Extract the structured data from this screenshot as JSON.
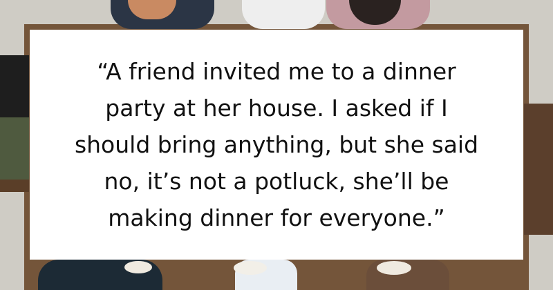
{
  "quote": {
    "lines": [
      "“A friend invited me to a dinner",
      "party at her house. I asked if I",
      "should bring anything, but she said",
      "no, it’s not a potluck, she’ll be",
      "making dinner for everyone.”"
    ]
  },
  "colors": {
    "card": "#ffffff",
    "text": "#111111",
    "table_wood": "#7a5a3e",
    "floor": "#d9d6cf"
  }
}
